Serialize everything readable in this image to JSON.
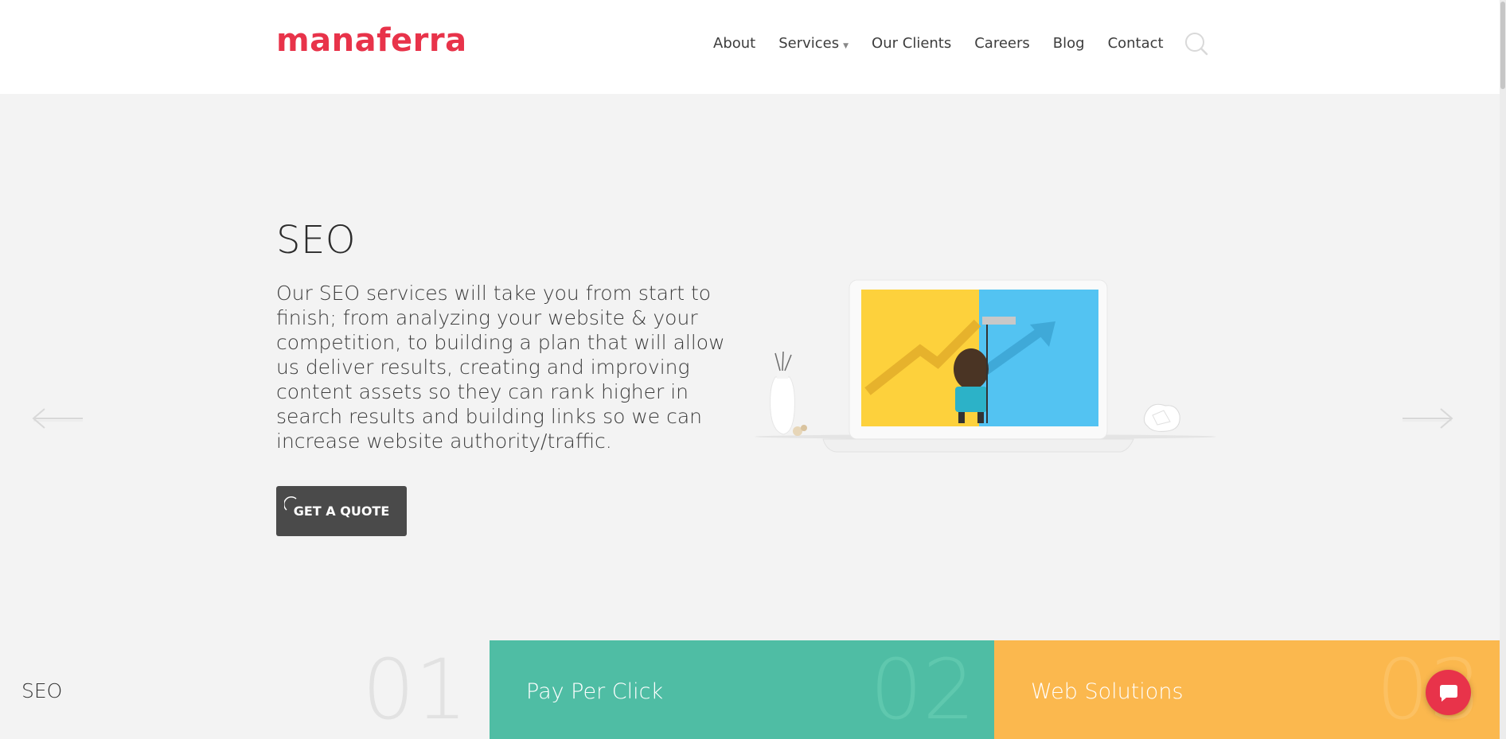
{
  "brand": {
    "logo_text": "manaferra",
    "accent": "#e8334a"
  },
  "nav": {
    "items": [
      {
        "label": "About"
      },
      {
        "label": "Services",
        "has_dropdown": true
      },
      {
        "label": "Our Clients"
      },
      {
        "label": "Careers"
      },
      {
        "label": "Blog"
      },
      {
        "label": "Contact"
      }
    ],
    "search_icon": "search-icon"
  },
  "hero": {
    "title": "SEO",
    "text": "Our SEO services will take you from start to finish; from analyzing your website & your competition, to building a plan that will allow us deliver results, creating and improving content assets so they can rank higher in search results and building links so we can increase website authority/traffic.",
    "cta_label": "GET A QUOTE",
    "prev_icon": "arrow-left-icon",
    "next_icon": "arrow-right-icon"
  },
  "tiles": [
    {
      "label": "SEO",
      "number": "01",
      "color": "#f3f3f3"
    },
    {
      "label": "Pay Per Click",
      "number": "02",
      "color": "#4fbda4"
    },
    {
      "label": "Web Solutions",
      "number": "03",
      "color": "#fbb84e"
    }
  ],
  "chat": {
    "icon": "chat-bubble-icon",
    "color": "#e8334a"
  }
}
